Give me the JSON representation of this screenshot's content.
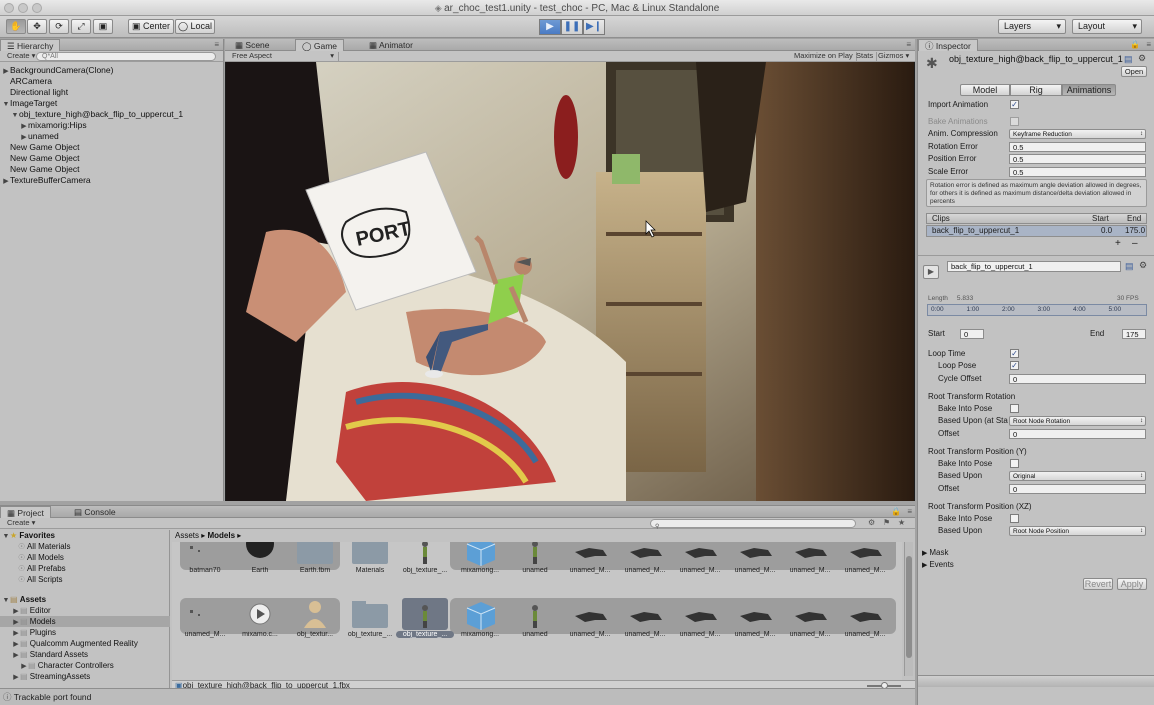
{
  "window": {
    "title": "ar_choc_test1.unity - test_choc - PC, Mac & Linux Standalone"
  },
  "toolbar": {
    "center_label": "Center",
    "local_label": "Local",
    "layers_label": "Layers",
    "layout_label": "Layout"
  },
  "hierarchy": {
    "tab": "Hierarchy",
    "create_label": "Create",
    "search_placeholder": "Q*All",
    "items": [
      {
        "label": "BackgroundCamera(Clone)",
        "depth": 0,
        "fold": "closed"
      },
      {
        "label": "ARCamera",
        "depth": 0,
        "fold": "none"
      },
      {
        "label": "Directional light",
        "depth": 0,
        "fold": "none"
      },
      {
        "label": "ImageTarget",
        "depth": 0,
        "fold": "open"
      },
      {
        "label": "obj_texture_high@back_flip_to_uppercut_1",
        "depth": 1,
        "fold": "open"
      },
      {
        "label": "mixamorig:Hips",
        "depth": 2,
        "fold": "closed"
      },
      {
        "label": "unamed",
        "depth": 2,
        "fold": "closed"
      },
      {
        "label": "New Game Object",
        "depth": 0,
        "fold": "none"
      },
      {
        "label": "New Game Object",
        "depth": 0,
        "fold": "none"
      },
      {
        "label": "New Game Object",
        "depth": 0,
        "fold": "none"
      },
      {
        "label": "TextureBufferCamera",
        "depth": 0,
        "fold": "closed"
      }
    ]
  },
  "scene_tabs": {
    "scene": "Scene",
    "game": "Game",
    "animator": "Animator"
  },
  "game_view": {
    "aspect": "Free Aspect",
    "maximize": "Maximize on Play",
    "stats": "Stats",
    "gizmos": "Gizmos",
    "card_text": "PORT"
  },
  "project": {
    "tab": "Project",
    "console_tab": "Console",
    "create_label": "Create",
    "favorites_label": "Favorites",
    "favorites": [
      "All Materials",
      "All Models",
      "All Prefabs",
      "All Scripts"
    ],
    "assets_label": "Assets",
    "folders": [
      "Editor",
      "Models",
      "Plugins",
      "Qualcomm Augmented Reality",
      "Standard Assets",
      "Character Controllers",
      "StreamingAssets"
    ],
    "breadcrumb_root": "Assets",
    "breadcrumb_current": "Models",
    "row1": [
      "batman70",
      "Earth",
      "Earth.fbm",
      "Materials",
      "obj_texture_...",
      "mixamorig...",
      "unamed",
      "unamed_M...",
      "unamed_M...",
      "unamed_M...",
      "unamed_M...",
      "unamed_M...",
      "unamed_M..."
    ],
    "row2": [
      "unamed_M...",
      "mixamo.c...",
      "obj_textur...",
      "obj_texture_...",
      "obj_texture_...",
      "mixamorig...",
      "unamed",
      "unamed_M...",
      "unamed_M...",
      "unamed_M...",
      "unamed_M...",
      "unamed_M...",
      "unamed_M..."
    ],
    "footer_path": "obj_texture_high@back_flip_to_uppercut_1.fbx"
  },
  "status": {
    "message": "Trackable port found"
  },
  "inspector": {
    "tab": "Inspector",
    "object_name": "obj_texture_high@back_flip_to_uppercut_1",
    "open_label": "Open",
    "tabs": [
      "Model",
      "Rig",
      "Animations"
    ],
    "import_animation": "Import Animation",
    "bake_animations": "Bake Animations",
    "anim_compression_label": "Anim. Compression",
    "anim_compression_value": "Keyframe Reduction",
    "rotation_error_label": "Rotation Error",
    "rotation_error": "0.5",
    "position_error_label": "Position Error",
    "position_error": "0.5",
    "scale_error_label": "Scale Error",
    "scale_error": "0.5",
    "help_text": "Rotation error is defined as maximum angle deviation allowed in degrees, for others it is defined as maximum distance/delta deviation allowed in percents",
    "clips_header": {
      "clips": "Clips",
      "start": "Start",
      "end": "End"
    },
    "clip": {
      "name": "back_flip_to_uppercut_1",
      "start": "0.0",
      "end": "175.0"
    },
    "clip_name_field": "back_flip_to_uppercut_1",
    "length_label": "Length",
    "length_value": "5.833",
    "fps_value": "30 FPS",
    "timeline_ticks": [
      "0:00",
      "1:00",
      "2:00",
      "3:00",
      "4:00",
      "5:00"
    ],
    "start_label": "Start",
    "start_value": "0",
    "end_label": "End",
    "end_value": "175",
    "loop_time": "Loop Time",
    "loop_pose": "Loop Pose",
    "cycle_offset_label": "Cycle Offset",
    "cycle_offset": "0",
    "rtr_header": "Root Transform Rotation",
    "bake_into_pose": "Bake Into Pose",
    "based_upon_start": "Based Upon (at Star",
    "based_upon": "Based Upon",
    "offset": "Offset",
    "rtr_based_value": "Root Node Rotation",
    "rtr_offset": "0",
    "rtpy_header": "Root Transform Position (Y)",
    "rtpy_based_value": "Original",
    "rtpy_offset": "0",
    "rtpxz_header": "Root Transform Position (XZ)",
    "rtpxz_based_value": "Root Node Position",
    "mask_label": "Mask",
    "events_label": "Events",
    "revert_label": "Revert",
    "apply_label": "Apply"
  }
}
